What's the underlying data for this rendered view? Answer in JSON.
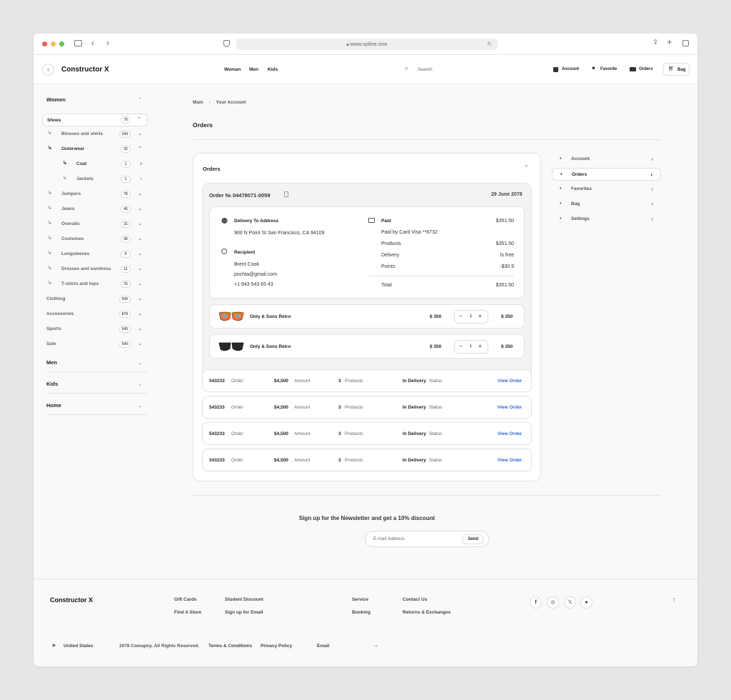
{
  "browser": {
    "url": "www.spline.one"
  },
  "header": {
    "brand": "Constructor X",
    "nav": [
      "Woman",
      "Men",
      "Kids"
    ],
    "search_placeholder": "Search",
    "actions": {
      "account": "Account",
      "favorite": "Favorite",
      "orders": "Orders",
      "bag": "Bag"
    }
  },
  "sidebar": {
    "women": "Women",
    "shoes": {
      "label": "Shoes",
      "count": "78"
    },
    "items": [
      {
        "label": "Blouses and shirts",
        "count": "244"
      },
      {
        "label": "Outerwear",
        "count": "32"
      },
      {
        "label": "Coat",
        "count": "1"
      },
      {
        "label": "Jackets",
        "count": "1"
      },
      {
        "label": "Jumpers",
        "count": "78"
      },
      {
        "label": "Jeans",
        "count": "45"
      },
      {
        "label": "Overalls",
        "count": "21"
      },
      {
        "label": "Costumes",
        "count": "36"
      },
      {
        "label": "Longsleeves",
        "count": "5"
      },
      {
        "label": "Dresses and sundress",
        "count": "11"
      },
      {
        "label": "T-shirts and tops",
        "count": "75"
      },
      {
        "label": "Clothing",
        "count": "545"
      },
      {
        "label": "Accessories",
        "count": "878"
      },
      {
        "label": "Sports",
        "count": "545"
      },
      {
        "label": "Sale",
        "count": "540"
      }
    ],
    "sections": [
      "Men",
      "Kids",
      "Home"
    ]
  },
  "breadcrumb": {
    "main": "Main",
    "current": "Your Account"
  },
  "page_title": "Orders",
  "orders_panel": {
    "title": "Orders",
    "order_number": "Order № 04478071-0059",
    "order_date": "29 June 2078",
    "delivery_label": "Delivery To Address",
    "address": "900 N Point St San Francisco, CA 94109",
    "recipient_label": "Recipient",
    "recipient_name": "Brent Cook",
    "recipient_email": "pochta@gmail.com",
    "recipient_phone": "+1 943 543 65 43",
    "paid_label": "Paid",
    "paid_amount": "$351.50",
    "paid_by": "Paid by Card Visa **8732",
    "summary": [
      {
        "label": "Products",
        "value": "$351.50"
      },
      {
        "label": "Delivery",
        "value": "Is free"
      },
      {
        "label": "Points",
        "value": "-$30.9"
      }
    ],
    "total_label": "Total",
    "total_value": "$351.50",
    "products": [
      {
        "name": "Only & Sons Retro",
        "price": "$ 350",
        "qty": "1",
        "total": "$ 350",
        "lens_color": "#e8762a"
      },
      {
        "name": "Only & Sons Retro",
        "price": "$ 350",
        "qty": "1",
        "total": "$ 350",
        "lens_color": "#2a2a2a"
      }
    ],
    "rows": [
      {
        "id": "543233",
        "id_label": "Order",
        "amount": "$4,500",
        "amount_label": "Amount",
        "products": "3",
        "products_label": "Products",
        "status": "In Delivery",
        "status_label": "Status",
        "action": "View Order"
      },
      {
        "id": "543233",
        "id_label": "Order",
        "amount": "$4,500",
        "amount_label": "Amount",
        "products": "3",
        "products_label": "Products",
        "status": "In Delivery",
        "status_label": "Status",
        "action": "View Order"
      },
      {
        "id": "543233",
        "id_label": "Order",
        "amount": "$4,500",
        "amount_label": "Amount",
        "products": "3",
        "products_label": "Products",
        "status": "In Delivery",
        "status_label": "Status",
        "action": "View Order"
      },
      {
        "id": "543233",
        "id_label": "Order",
        "amount": "$4,500",
        "amount_label": "Amount",
        "products": "3",
        "products_label": "Products",
        "status": "In Delivery",
        "status_label": "Status",
        "action": "View Order"
      }
    ]
  },
  "account_menu": [
    "Account",
    "Orders",
    "Favorites",
    "Bag",
    "Settings"
  ],
  "newsletter": {
    "title": "Sign up for the Newsletter and get a 10% discount",
    "placeholder": "E-mail Address",
    "send": "Send"
  },
  "footer": {
    "brand": "Constructor X",
    "links": [
      "Gift Cards",
      "Student Discount",
      "Find A Store",
      "Sign up for Email",
      "Service",
      "Contact Us",
      "Booking",
      "Returns & Exchanges"
    ],
    "country": "United States",
    "copyright": "2078 Comapny. All Rights Reserved.",
    "terms": "Terms & Conditions",
    "privacy": "Privacy Policy",
    "email": "Email"
  }
}
